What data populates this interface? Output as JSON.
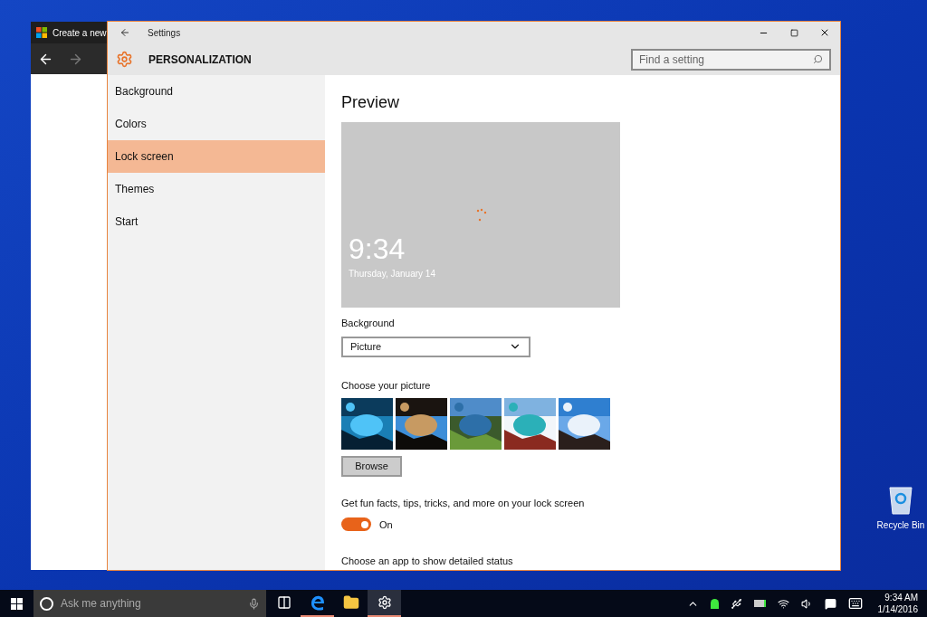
{
  "desktop": {
    "icons": [
      {
        "label": "Recycle Bin"
      }
    ]
  },
  "browser_window": {
    "title": "Create a new"
  },
  "settings": {
    "title": "Settings",
    "header": "PERSONALIZATION",
    "search": {
      "placeholder": "Find a setting"
    },
    "nav": [
      {
        "label": "Background",
        "selected": false
      },
      {
        "label": "Colors",
        "selected": false
      },
      {
        "label": "Lock screen",
        "selected": true
      },
      {
        "label": "Themes",
        "selected": false
      },
      {
        "label": "Start",
        "selected": false
      }
    ],
    "content": {
      "heading": "Preview",
      "preview": {
        "time": "9:34",
        "date": "Thursday, January 14"
      },
      "background": {
        "label": "Background",
        "value": "Picture"
      },
      "pictures": {
        "label": "Choose your picture"
      },
      "browse": "Browse",
      "tips": {
        "label": "Get fun facts, tips, tricks, and more on your lock screen",
        "on": true,
        "state_text": "On"
      },
      "status_label": "Choose an app to show detailed status"
    }
  },
  "taskbar": {
    "search_placeholder": "Ask me anything",
    "apps": [
      {
        "kind": "task-view",
        "running": false,
        "selected": false
      },
      {
        "kind": "edge",
        "running": true,
        "selected": false
      },
      {
        "kind": "explorer",
        "running": false,
        "selected": false
      },
      {
        "kind": "settings",
        "running": true,
        "selected": true
      }
    ],
    "clock": {
      "time": "9:34 AM",
      "date": "1/14/2016"
    }
  }
}
